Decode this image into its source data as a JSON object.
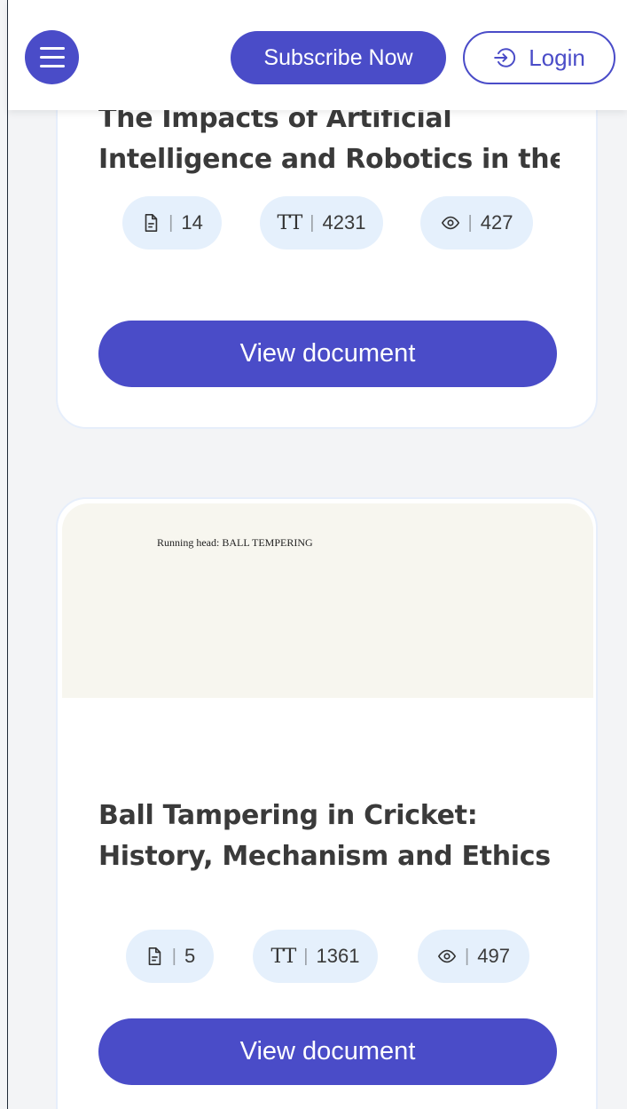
{
  "header": {
    "subscribe_label": "Subscribe Now",
    "login_label": "Login",
    "accent_color": "#4a4cc8"
  },
  "cards": [
    {
      "title_lines": [
        "The Impacts of Artificial",
        "Intelligence and Robotics in the..."
      ],
      "pages": "14",
      "words": "4231",
      "views": "427",
      "button_label": "View document"
    },
    {
      "preview_text": "Running head: BALL TEMPERING",
      "title": "Ball Tampering in Cricket: History, Mechanism and Ethics",
      "pages": "5",
      "words": "1361",
      "views": "497",
      "button_label": "View document"
    }
  ],
  "stats": {
    "separator": "|",
    "word_icon_glyph": "TT"
  },
  "icons": {
    "menu": "hamburger-icon",
    "login": "login-icon",
    "pages": "document-icon",
    "words": "text-size-icon",
    "views": "eye-icon"
  }
}
